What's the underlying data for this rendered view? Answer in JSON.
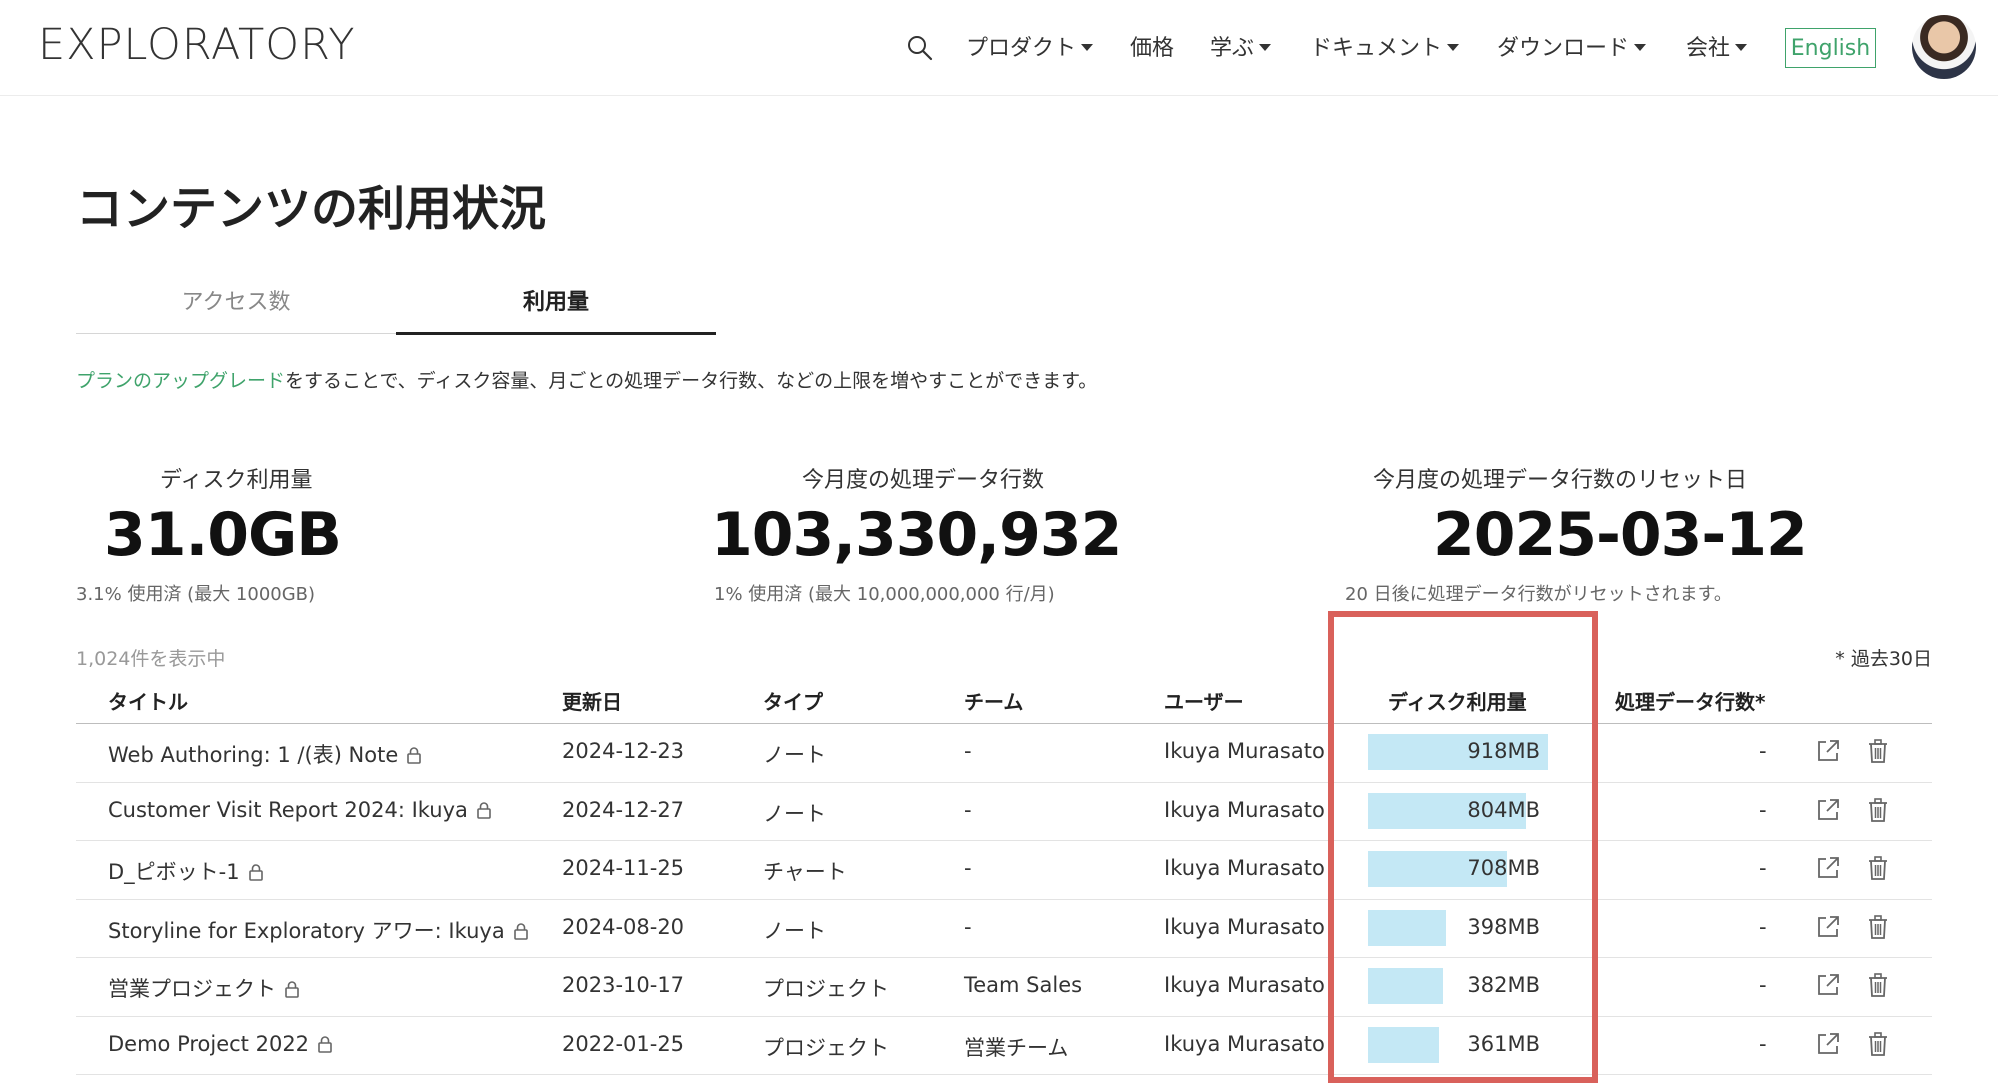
{
  "header": {
    "logo": "EXPLORATORY",
    "nav": [
      {
        "label": "プロダクト",
        "dropdown": true
      },
      {
        "label": "価格",
        "dropdown": false
      },
      {
        "label": "学ぶ",
        "dropdown": true
      },
      {
        "label": "ドキュメント",
        "dropdown": true
      },
      {
        "label": "ダウンロード",
        "dropdown": true
      },
      {
        "label": "会社",
        "dropdown": true
      }
    ],
    "lang_button": "English",
    "accent_color": "#3fa36b"
  },
  "page": {
    "title": "コンテンツの利用状況",
    "tabs": [
      {
        "label": "アクセス数",
        "active": false
      },
      {
        "label": "利用量",
        "active": true
      }
    ],
    "upgrade_link": "プランのアップグレード",
    "upgrade_text": "をすることで、ディスク容量、月ごとの処理データ行数、などの上限を増やすことができます。"
  },
  "stats": {
    "disk": {
      "label": "ディスク利用量",
      "value": "31.0GB",
      "sub": "3.1% 使用済 (最大 1000GB)"
    },
    "rows": {
      "label": "今月度の処理データ行数",
      "value": "103,330,932",
      "sub": "1% 使用済 (最大 10,000,000,000 行/月)"
    },
    "reset": {
      "label": "今月度の処理データ行数のリセット日",
      "value": "2025-03-12",
      "sub": "20 日後に処理データ行数がリセットされます。"
    }
  },
  "table": {
    "count": "1,024件を表示中",
    "footnote": "* 過去30日",
    "columns": {
      "title": "タイトル",
      "updated": "更新日",
      "type": "タイプ",
      "team": "チーム",
      "user": "ユーザー",
      "disk": "ディスク利用量",
      "rows": "処理データ行数*"
    },
    "disk_max_mb": 918,
    "bar_color": "#c4e8f5",
    "highlight_color": "#d9615b",
    "rows": [
      {
        "title": "Web Authoring: 1 /(表) Note",
        "updated": "2024-12-23",
        "type": "ノート",
        "team": "-",
        "user": "Ikuya Murasato",
        "disk": "918MB",
        "disk_mb": 918,
        "rows": "-"
      },
      {
        "title": "Customer Visit Report 2024: Ikuya",
        "updated": "2024-12-27",
        "type": "ノート",
        "team": "-",
        "user": "Ikuya Murasato",
        "disk": "804MB",
        "disk_mb": 804,
        "rows": "-"
      },
      {
        "title": "D_ピボット-1",
        "updated": "2024-11-25",
        "type": "チャート",
        "team": "-",
        "user": "Ikuya Murasato",
        "disk": "708MB",
        "disk_mb": 708,
        "rows": "-"
      },
      {
        "title": "Storyline for Exploratory アワー: Ikuya",
        "updated": "2024-08-20",
        "type": "ノート",
        "team": "-",
        "user": "Ikuya Murasato",
        "disk": "398MB",
        "disk_mb": 398,
        "rows": "-"
      },
      {
        "title": "営業プロジェクト",
        "updated": "2023-10-17",
        "type": "プロジェクト",
        "team": "Team Sales",
        "user": "Ikuya Murasato",
        "disk": "382MB",
        "disk_mb": 382,
        "rows": "-"
      },
      {
        "title": "Demo Project 2022",
        "updated": "2022-01-25",
        "type": "プロジェクト",
        "team": "営業チーム",
        "user": "Ikuya Murasato",
        "disk": "361MB",
        "disk_mb": 361,
        "rows": "-"
      }
    ]
  }
}
